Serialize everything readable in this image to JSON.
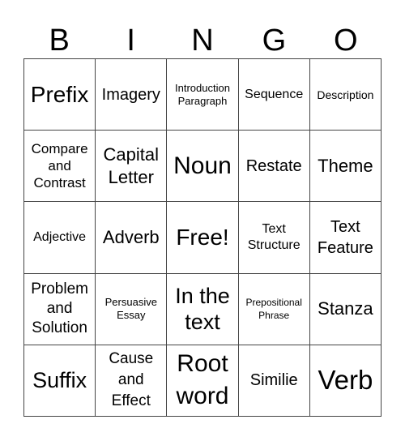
{
  "title_letters": [
    "B",
    "I",
    "N",
    "G",
    "O"
  ],
  "cells": [
    [
      "Prefix",
      "Imagery",
      "Introduction Paragraph",
      "Sequence",
      "Description"
    ],
    [
      "Compare and Contrast",
      "Capital Letter",
      "Noun",
      "Restate",
      "Theme"
    ],
    [
      "Adjective",
      "Adverb",
      "Free!",
      "Text Structure",
      "Text Feature"
    ],
    [
      "Problem and Solution",
      "Persuasive Essay",
      "In the text",
      "Prepositional Phrase",
      "Stanza"
    ],
    [
      "Suffix",
      "Cause and Effect",
      "Root word",
      "Similie",
      "Verb"
    ]
  ]
}
